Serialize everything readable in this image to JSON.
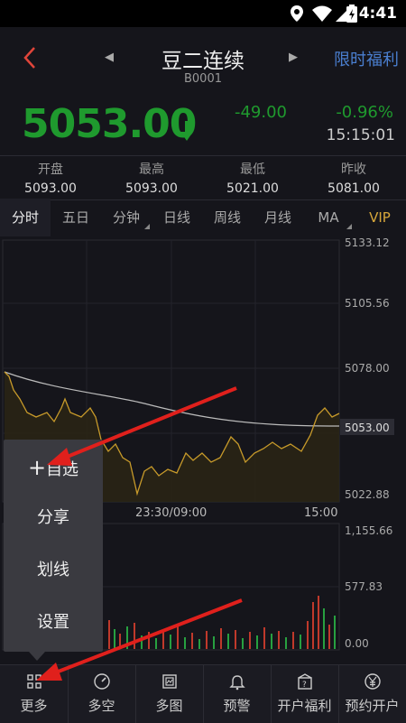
{
  "status_bar": {
    "time": "4:41"
  },
  "header": {
    "title": "豆二连续",
    "code": "B0001",
    "promo": "限时福利"
  },
  "quote": {
    "price": "5053.00",
    "change": "-49.00",
    "change_pct": "-0.96%",
    "time": "15:15:01",
    "price_color": "#1f9a2e"
  },
  "stats": [
    {
      "label": "开盘",
      "value": "5093.00"
    },
    {
      "label": "最高",
      "value": "5093.00"
    },
    {
      "label": "最低",
      "value": "5021.00"
    },
    {
      "label": "昨收",
      "value": "5081.00"
    }
  ],
  "tabs": [
    "分时",
    "五日",
    "分钟",
    "日线",
    "周线",
    "月线",
    "MA",
    "VIP"
  ],
  "active_tab": "分时",
  "chart": {
    "price_axis": [
      "5133.12",
      "5105.56",
      "5078.00",
      "5053.00",
      "5022.88"
    ],
    "time_axis": [
      "23:30/09:00",
      "15:00"
    ],
    "volume_axis": [
      "1,155.66",
      "577.83",
      "0.00"
    ]
  },
  "popup_menu": {
    "items": [
      "自选",
      "分享",
      "划线",
      "设置"
    ],
    "add_symbol": "+"
  },
  "bottom_bar": [
    {
      "label": "更多",
      "icon": "grid-icon"
    },
    {
      "label": "多空",
      "icon": "gauge-icon"
    },
    {
      "label": "多图",
      "icon": "multi-chart-icon"
    },
    {
      "label": "预警",
      "icon": "bell-icon"
    },
    {
      "label": "开户福利",
      "icon": "gift-question-icon"
    },
    {
      "label": "预约开户",
      "icon": "yen-icon"
    }
  ],
  "colors": {
    "background": "#15151b",
    "down_green": "#1f9a2e",
    "price_line": "#c79a2a",
    "avg_line": "#bbbbbb",
    "annotation_arrow": "#e0201c",
    "link_blue": "#4a7fd0"
  }
}
